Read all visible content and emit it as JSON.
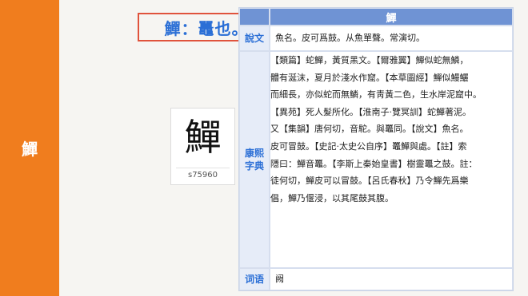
{
  "sidebar": {
    "char": "鱓"
  },
  "headline": "鱓：鼉也。",
  "seal": {
    "glyph": "鱓",
    "code": "s75960"
  },
  "table": {
    "header_char": "鱓",
    "shuowen": {
      "label": "說文",
      "text": "魚名。皮可爲鼓。从魚單聲。常演切。"
    },
    "kangxi": {
      "label_line1": "康熙",
      "label_line2": "字典",
      "lines": [
        "【類篇】蛇鱓，黃質黑文。【爾雅翼】鱓似蛇無鱗，",
        "體有涎沫，夏月於淺水作窟。【本草圖經】鱓似鰻鱺",
        "而細長，亦似蛇而無鱗，有靑黃二色，生水岸泥窟中。",
        "【異苑】死人髮所化。【淮南子·覽冥訓】蛇鱓著泥。",
        "又【集韻】唐何切，音駝。與鼉同。【說文】魚名。",
        "皮可冒鼓。【史記·太史公自序】鼉鱓與處。【註】索",
        "隱曰：鱓音鼉。【李斯上秦始皇書】樹靈鼉之鼓。註：",
        "徒何切，鱓皮可以冒鼓。【呂氏春秋】乃令鱓先爲樂",
        "倡，鱓乃偃浸，以其尾鼓其腹。"
      ]
    },
    "ciyu": {
      "label": "词语",
      "text": "阙"
    }
  }
}
